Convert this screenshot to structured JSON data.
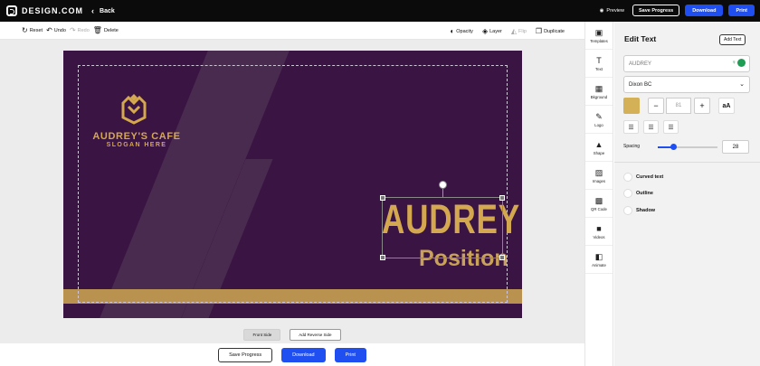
{
  "topbar": {
    "logo_text": "DESIGN.COM",
    "back_label": "Back",
    "preview_label": "Preview",
    "save_progress_label": "Save Progress",
    "download_label": "Download",
    "print_label": "Print"
  },
  "toolbar": {
    "reset_label": "Reset",
    "undo_label": "Undo",
    "redo_label": "Redo",
    "delete_label": "Delete",
    "opacity_label": "Opacity",
    "layer_label": "Layer",
    "flip_label": "Flip",
    "duplicate_label": "Duplicate"
  },
  "card": {
    "brand_name": "AUDREY'S CAFE",
    "slogan": "SLOGAN HERE",
    "name": "AUDREY",
    "position": "Position",
    "colors": {
      "background": "#3a1442",
      "gold": "#d4a84f"
    }
  },
  "sides": {
    "front_label": "Front Side",
    "add_reverse_label": "Add Reverse Side"
  },
  "bottom_actions": {
    "save_progress_label": "Save Progress",
    "download_label": "Download",
    "print_label": "Print"
  },
  "rail": {
    "items": [
      {
        "label": "Templates",
        "icon": "templates-icon",
        "glyph": "▣"
      },
      {
        "label": "Text",
        "icon": "text-icon",
        "glyph": "T"
      },
      {
        "label": "Bkground",
        "icon": "background-icon",
        "glyph": "▦"
      },
      {
        "label": "Logo",
        "icon": "logo-icon",
        "glyph": "✎"
      },
      {
        "label": "Shape",
        "icon": "shape-icon",
        "glyph": "▲"
      },
      {
        "label": "Images",
        "icon": "image-icon",
        "glyph": "▨"
      },
      {
        "label": "QR Code",
        "icon": "qr-code-icon",
        "glyph": "▩"
      },
      {
        "label": "Videos",
        "icon": "video-icon",
        "glyph": "■"
      },
      {
        "label": "Animate",
        "icon": "animate-icon",
        "glyph": "◧"
      }
    ]
  },
  "panel": {
    "title": "Edit Text",
    "add_text_label": "Add Text",
    "text_value": "AUDREY",
    "font_value": "Dixon BC",
    "font_color": "#d4b057",
    "font_size": "81",
    "minus_label": "−",
    "plus_label": "+",
    "case_label": "aA",
    "spacing_label": "Spacing",
    "spacing_value": "28",
    "spacing_fraction": 0.26,
    "curved_text_label": "Curved text",
    "outline_label": "Outline",
    "shadow_label": "Shadow"
  }
}
